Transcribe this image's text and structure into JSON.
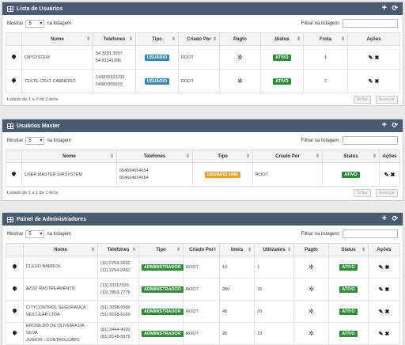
{
  "common": {
    "show_label": "Mostrar",
    "show_value": "5",
    "show_suffix": "na listagem",
    "filter_label": "Filtrar na listagem:",
    "prev": "Voltar",
    "next": "Avançar",
    "add_icon": "plus-icon",
    "refresh_icon": "refresh-icon"
  },
  "users": {
    "title": "Lista de Usuários",
    "headers": [
      "",
      "Nome",
      "Telefones",
      "Tipo",
      "Criado Por",
      "Pagto",
      "Status",
      "Frota",
      "Ações"
    ],
    "rows": [
      {
        "name": "DIPSYSTEM",
        "phone1": "54 3291 3597",
        "phone2": "54 81341096",
        "type": "USUÁRIO",
        "created_by": "ROOT",
        "status": "ATIVO",
        "frota": "1"
      },
      {
        "name": "TESTE CRX1 CARNEIRO",
        "phone1": "143232323232",
        "phone2": "14981005933",
        "type": "USUÁRIO",
        "created_by": "ROOT",
        "status": "ATIVO",
        "frota": "2"
      }
    ],
    "info": "Listado de 1 a 2 de 2 itens"
  },
  "masters": {
    "title": "Usuários Master",
    "headers": [
      "",
      "Nome",
      "Telefones",
      "Tipo",
      "Criado Por",
      "Status",
      "Ações"
    ],
    "rows": [
      {
        "name": "USER MASTER DIPSYSTEM",
        "phone1": "654654654654",
        "phone2": "654654654654",
        "type": "USUÁRIO UNR",
        "created_by": "ROOT",
        "status": "ATIVO"
      }
    ],
    "info": "Listado de 1 a 1 de 1 itens"
  },
  "admins": {
    "title": "Painel de Administradores",
    "headers": [
      "",
      "Nome",
      "Telefones",
      "Tipo",
      "Criado Por",
      "Imeis",
      "Utilizados",
      "Pagto",
      "Status",
      "Ações"
    ],
    "rows": [
      {
        "name1": "CLEUO BARROS",
        "name2": "",
        "phone1": "(11) 2754-2432",
        "phone2": "(11) 2754-2432",
        "type": "ADMINISTRADOR",
        "created_by": "ROOT",
        "imeis": "10",
        "used": "1",
        "status": "ATIVO"
      },
      {
        "name1": "AZOZ RASTREAMENTO",
        "name2": "",
        "phone1": "(13) 33267929",
        "phone2": "(13) 7803-7775",
        "type": "ADMINISTRADOR",
        "created_by": "ROOT",
        "imeis": "290",
        "used": "33",
        "status": "ATIVO"
      },
      {
        "name1": "CITYCONTROL SEGURANÇA",
        "name2": "VEICULAR LTDA",
        "phone1": "(51) 3058-0586",
        "phone2": "(51) 8108-6169",
        "type": "ADMINISTRADOR",
        "created_by": "ROOT",
        "imeis": "48",
        "used": "29",
        "status": "ATIVO"
      },
      {
        "name1": "ERONILDO DE OLIVEIRA DA SILVA",
        "name2": "JUNIOR - CONTROLCARS",
        "phone1": "(81) 3444-4030",
        "phone2": "(81) 8148-5575",
        "type": "ADMINISTRADOR",
        "created_by": "ROOT",
        "imeis": "25",
        "used": "19",
        "status": "ATIVO"
      }
    ]
  },
  "colors": {
    "header": "#4a5a70",
    "ativo": "#2f8a3a",
    "usuario": "#3a87ad",
    "unr": "#f0a030"
  }
}
